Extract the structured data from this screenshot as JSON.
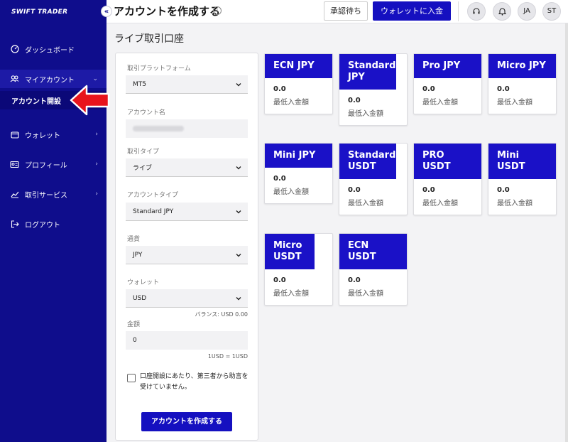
{
  "sidebar": {
    "logo": "SWIFT TRADER",
    "collapse": "«",
    "items": [
      {
        "label": "ダッシュボード"
      },
      {
        "label": "マイアカウント"
      },
      {
        "label": "アカウント開設"
      },
      {
        "label": "ウォレット"
      },
      {
        "label": "プロフィール"
      },
      {
        "label": "取引サービス"
      },
      {
        "label": "ログアウト"
      }
    ]
  },
  "header": {
    "title": "アカウントを作成する",
    "pending_label": "承認待ち",
    "deposit_label": "ウォレットに入金",
    "avatar1": "JA",
    "avatar2": "ST"
  },
  "main": {
    "section_title": "ライブ取引口座",
    "form": {
      "platform_label": "取引プラットフォーム",
      "platform_value": "MT5",
      "account_name_label": "アカウント名",
      "trade_type_label": "取引タイプ",
      "trade_type_value": "ライブ",
      "account_type_label": "アカウントタイプ",
      "account_type_value": "Standard JPY",
      "currency_label": "通貨",
      "currency_value": "JPY",
      "wallet_label": "ウォレット",
      "wallet_value": "USD",
      "balance_note": "バランス: USD 0.00",
      "amount_label": "金額",
      "amount_value": "0",
      "rate_note": "1USD = 1USD",
      "consent_text": "口座開設にあたり、第三者から助言を受けていません。",
      "submit_label": "アカウントを作成する"
    },
    "cards": [
      {
        "name": "ECN JPY",
        "value": "0.0",
        "sub": "最低入金額"
      },
      {
        "name": "Standard JPY",
        "value": "0.0",
        "sub": "最低入金額"
      },
      {
        "name": "Pro JPY",
        "value": "0.0",
        "sub": "最低入金額"
      },
      {
        "name": "Micro JPY",
        "value": "0.0",
        "sub": "最低入金額"
      },
      {
        "name": "Mini JPY",
        "value": "0.0",
        "sub": "最低入金額"
      },
      {
        "name": "Standard USDT",
        "value": "0.0",
        "sub": "最低入金額"
      },
      {
        "name": "PRO USDT",
        "value": "0.0",
        "sub": "最低入金額"
      },
      {
        "name": "Mini USDT",
        "value": "0.0",
        "sub": "最低入金額"
      },
      {
        "name": "Micro USDT",
        "value": "0.0",
        "sub": "最低入金額"
      },
      {
        "name": "ECN USDT",
        "value": "0.0",
        "sub": "最低入金額"
      }
    ]
  },
  "colors": {
    "sidebar_bg": "#0f0d8c",
    "accent": "#1510c0",
    "arrow": "#e8141c"
  }
}
